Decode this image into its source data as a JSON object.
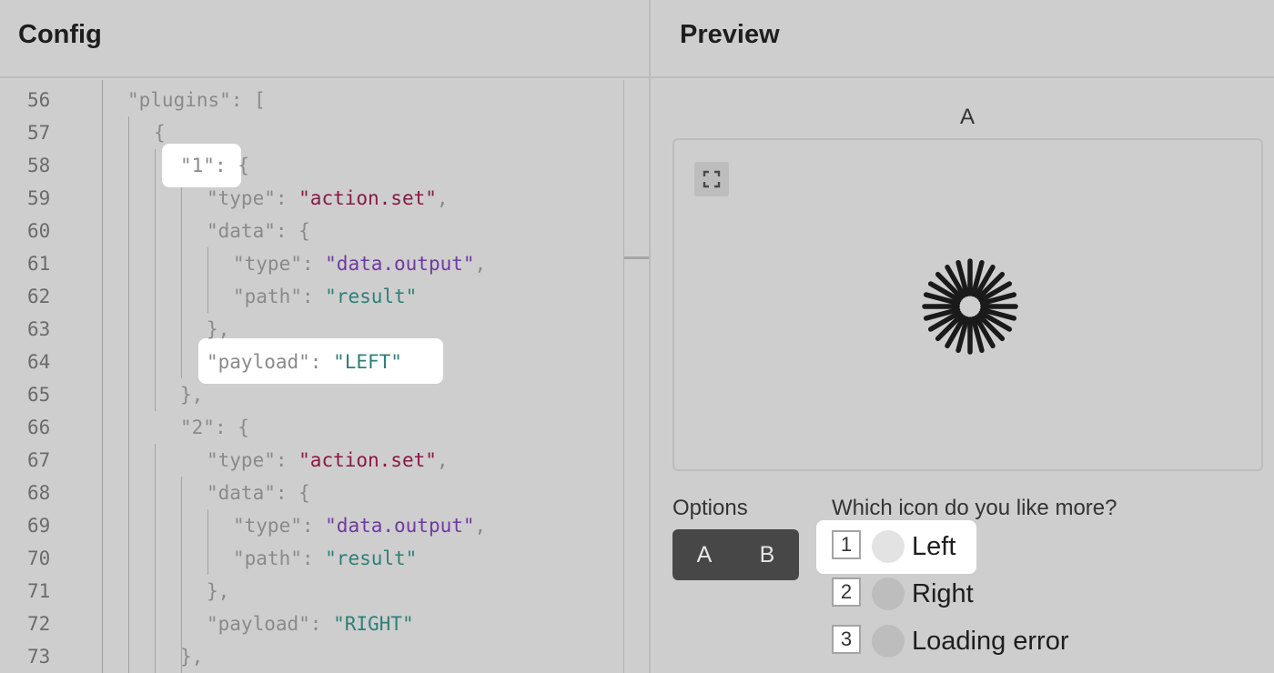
{
  "header": {
    "config_title": "Config",
    "preview_title": "Preview"
  },
  "editor": {
    "lines": [
      {
        "n": "56",
        "parts": [
          [
            "k",
            "\"plugins\""
          ],
          [
            "p",
            ": ["
          ]
        ]
      },
      {
        "n": "57",
        "parts": [
          [
            "p",
            "{"
          ]
        ]
      },
      {
        "n": "58",
        "parts": [
          [
            "k",
            "\"1\""
          ],
          [
            "p",
            ": {"
          ]
        ]
      },
      {
        "n": "59",
        "parts": [
          [
            "k",
            "\"type\""
          ],
          [
            "p",
            ": "
          ],
          [
            "s-red",
            "\"action.set\""
          ],
          [
            "p",
            ","
          ]
        ]
      },
      {
        "n": "60",
        "parts": [
          [
            "k",
            "\"data\""
          ],
          [
            "p",
            ": {"
          ]
        ]
      },
      {
        "n": "61",
        "parts": [
          [
            "k",
            "\"type\""
          ],
          [
            "p",
            ": "
          ],
          [
            "s-purple",
            "\"data.output\""
          ],
          [
            "p",
            ","
          ]
        ]
      },
      {
        "n": "62",
        "parts": [
          [
            "k",
            "\"path\""
          ],
          [
            "p",
            ": "
          ],
          [
            "s-teal",
            "\"result\""
          ]
        ]
      },
      {
        "n": "63",
        "parts": [
          [
            "p",
            "},"
          ]
        ]
      },
      {
        "n": "64",
        "parts": [
          [
            "k",
            "\"payload\""
          ],
          [
            "p",
            ": "
          ],
          [
            "s-teal",
            "\"LEFT\""
          ]
        ]
      },
      {
        "n": "65",
        "parts": [
          [
            "p",
            "},"
          ]
        ]
      },
      {
        "n": "66",
        "parts": [
          [
            "k",
            "\"2\""
          ],
          [
            "p",
            ": {"
          ]
        ]
      },
      {
        "n": "67",
        "parts": [
          [
            "k",
            "\"type\""
          ],
          [
            "p",
            ": "
          ],
          [
            "s-red",
            "\"action.set\""
          ],
          [
            "p",
            ","
          ]
        ]
      },
      {
        "n": "68",
        "parts": [
          [
            "k",
            "\"data\""
          ],
          [
            "p",
            ": {"
          ]
        ]
      },
      {
        "n": "69",
        "parts": [
          [
            "k",
            "\"type\""
          ],
          [
            "p",
            ": "
          ],
          [
            "s-purple",
            "\"data.output\""
          ],
          [
            "p",
            ","
          ]
        ]
      },
      {
        "n": "70",
        "parts": [
          [
            "k",
            "\"path\""
          ],
          [
            "p",
            ": "
          ],
          [
            "s-teal",
            "\"result\""
          ]
        ]
      },
      {
        "n": "71",
        "parts": [
          [
            "p",
            "},"
          ]
        ]
      },
      {
        "n": "72",
        "parts": [
          [
            "k",
            "\"payload\""
          ],
          [
            "p",
            ": "
          ],
          [
            "s-teal",
            "\"RIGHT\""
          ]
        ]
      },
      {
        "n": "73",
        "parts": [
          [
            "p",
            "},"
          ]
        ]
      }
    ]
  },
  "preview": {
    "image_label": "A",
    "options_label": "Options",
    "toggle": [
      "A",
      "B"
    ],
    "question": "Which icon do you like more?",
    "choices": [
      {
        "key": "1",
        "label": "Left",
        "selected": true
      },
      {
        "key": "2",
        "label": "Right",
        "selected": false
      },
      {
        "key": "3",
        "label": "Loading error",
        "selected": false
      }
    ]
  },
  "icons": {
    "expand": "expand-icon",
    "spinner": "loading-spinner-icon"
  },
  "colors": {
    "background": "#cecece",
    "highlight": "#ffffff",
    "toggle_bg": "#474747"
  }
}
